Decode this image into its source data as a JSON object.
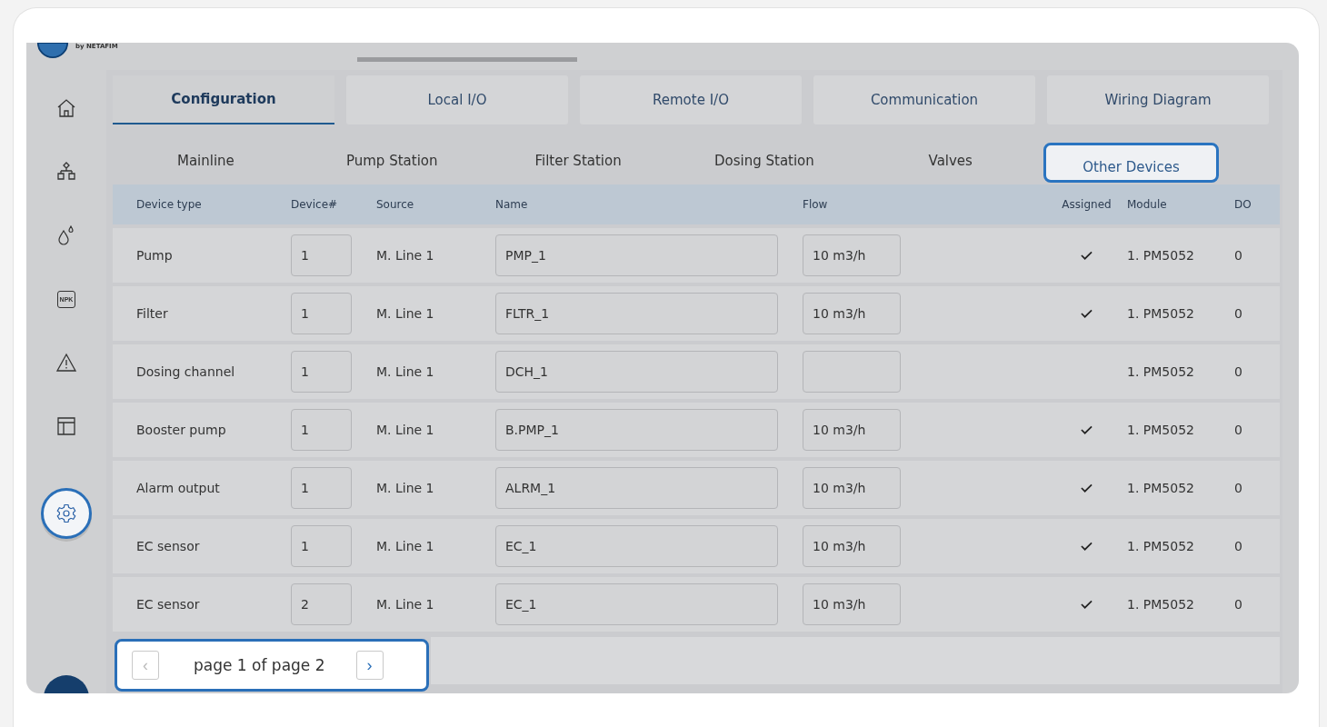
{
  "header": {
    "brand": "by NETAFIM"
  },
  "sidebar": {
    "items": [
      {
        "kind": "home",
        "selected": false
      },
      {
        "kind": "hierarchy",
        "selected": false
      },
      {
        "kind": "drops",
        "selected": false
      },
      {
        "kind": "npk",
        "label": "NPK",
        "selected": false
      },
      {
        "kind": "alert",
        "selected": false
      },
      {
        "kind": "table",
        "selected": false
      },
      {
        "kind": "settings",
        "selected": true
      }
    ]
  },
  "tabs": [
    {
      "label": "Configuration",
      "selected": true
    },
    {
      "label": "Local I/O",
      "selected": false
    },
    {
      "label": "Remote I/O",
      "selected": false
    },
    {
      "label": "Communication",
      "selected": false
    },
    {
      "label": "Wiring Diagram",
      "selected": false
    }
  ],
  "subtabs": [
    {
      "label": "Mainline",
      "selected": false
    },
    {
      "label": "Pump Station",
      "selected": false
    },
    {
      "label": "Filter Station",
      "selected": false
    },
    {
      "label": "Dosing Station",
      "selected": false
    },
    {
      "label": "Valves",
      "selected": false
    },
    {
      "label": "Other Devices",
      "selected": true
    }
  ],
  "table": {
    "columns": [
      "Device type",
      "Device#",
      "Source",
      "Name",
      "Flow",
      "Assigned",
      "Module",
      "DO"
    ],
    "rows": [
      {
        "device_type": "Pump",
        "device_no": "1",
        "source": "M. Line 1",
        "name": "PMP_1",
        "flow": "10 m3/h",
        "assigned": true,
        "module": "1. PM5052",
        "do": "0"
      },
      {
        "device_type": "Filter",
        "device_no": "1",
        "source": "M. Line 1",
        "name": "FLTR_1",
        "flow": "10 m3/h",
        "assigned": true,
        "module": "1. PM5052",
        "do": "0"
      },
      {
        "device_type": "Dosing channel",
        "device_no": "1",
        "source": "M. Line 1",
        "name": "DCH_1",
        "assigned": false,
        "module": "1. PM5052",
        "do": "0"
      },
      {
        "device_type": "Booster pump",
        "device_no": "1",
        "source": "M. Line 1",
        "name": "B.PMP_1",
        "flow": "10 m3/h",
        "assigned": true,
        "module": "1. PM5052",
        "do": "0"
      },
      {
        "device_type": "Alarm output",
        "device_no": "1",
        "source": "M. Line 1",
        "name": "ALRM_1",
        "flow": "10 m3/h",
        "assigned": true,
        "module": "1. PM5052",
        "do": "0"
      },
      {
        "device_type": "EC sensor",
        "device_no": "1",
        "source": "M. Line 1",
        "name": "EC_1",
        "flow": "10 m3/h",
        "assigned": true,
        "module": "1. PM5052",
        "do": "0"
      },
      {
        "device_type": "EC sensor",
        "device_no": "2",
        "source": "M. Line 1",
        "name": "EC_1",
        "flow": "10 m3/h",
        "assigned": true,
        "module": "1. PM5052",
        "do": "0"
      }
    ]
  },
  "pagination": {
    "prev_icon": "‹",
    "text": "page 1 of page 2",
    "next_icon": "›",
    "prev_disabled": true
  }
}
